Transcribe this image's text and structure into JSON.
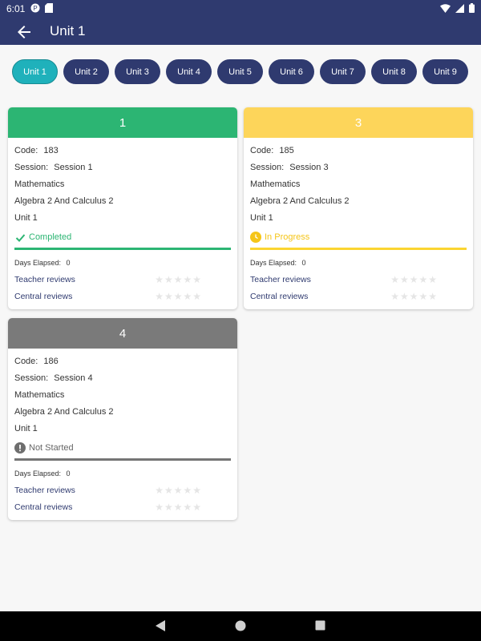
{
  "statusbar": {
    "time": "6:01"
  },
  "appbar": {
    "title": "Unit 1"
  },
  "chips": [
    "Unit 1",
    "Unit 2",
    "Unit 3",
    "Unit 4",
    "Unit 5",
    "Unit 6",
    "Unit 7",
    "Unit 8",
    "Unit 9"
  ],
  "cards": [
    {
      "number": "1",
      "code_label": "Code:",
      "code": "183",
      "session_label": "Session:",
      "session": "Session 1",
      "subject": "Mathematics",
      "course": "Algebra 2 And Calculus 2",
      "unit": "Unit 1",
      "status": "Completed",
      "status_icon": "check-icon",
      "days_label": "Days Elapsed:",
      "days": "0",
      "teacher_reviews": "Teacher reviews",
      "central_reviews": "Central reviews",
      "colors": {
        "header": "#2cb573",
        "status": "#2cb573",
        "bar": "#2cb573"
      }
    },
    {
      "number": "3",
      "code_label": "Code:",
      "code": "185",
      "session_label": "Session:",
      "session": "Session 3",
      "subject": "Mathematics",
      "course": "Algebra 2 And Calculus 2",
      "unit": "Unit 1",
      "status": "In Progress",
      "status_icon": "clock-icon",
      "days_label": "Days Elapsed:",
      "days": "0",
      "teacher_reviews": "Teacher reviews",
      "central_reviews": "Central reviews",
      "colors": {
        "header": "#fdd55a",
        "status": "#f5c518",
        "bar": "#fbd531"
      }
    },
    {
      "number": "4",
      "code_label": "Code:",
      "code": "186",
      "session_label": "Session:",
      "session": "Session 4",
      "subject": "Mathematics",
      "course": "Algebra 2 And Calculus 2",
      "unit": "Unit 1",
      "status": "Not Started",
      "status_icon": "exclamation-icon",
      "days_label": "Days Elapsed:",
      "days": "0",
      "teacher_reviews": "Teacher reviews",
      "central_reviews": "Central reviews",
      "colors": {
        "header": "#7a7a7a",
        "status": "#666666",
        "bar": "#757575"
      }
    }
  ],
  "colors": {
    "primary": "#2f3a6f",
    "active_chip": "#1fb1bb"
  }
}
